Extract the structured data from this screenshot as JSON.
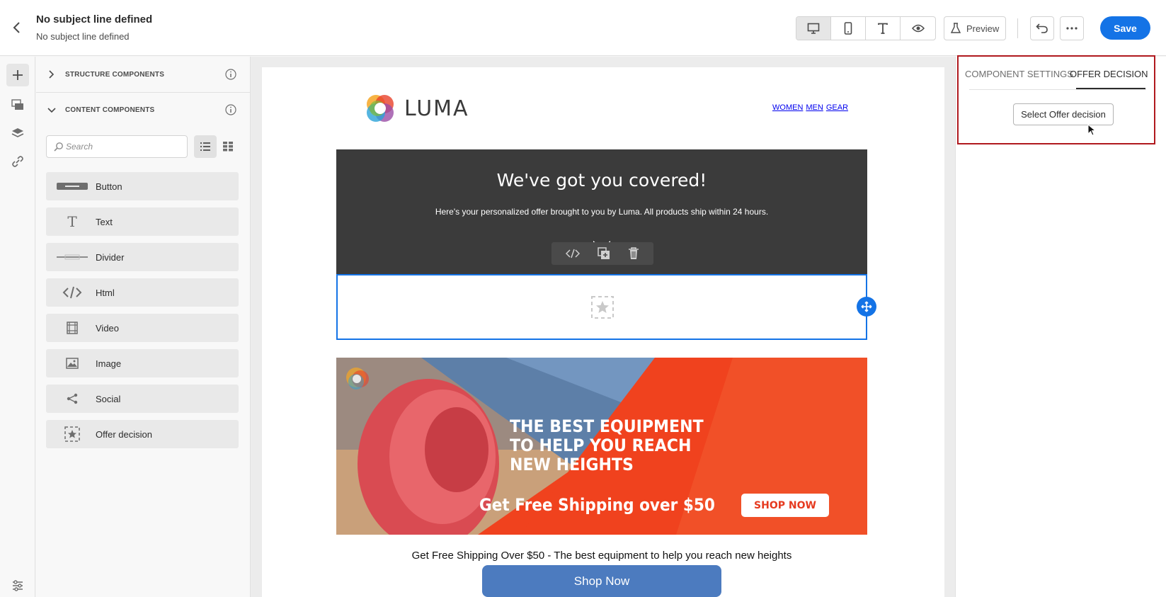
{
  "header": {
    "title": "No subject line defined",
    "subtitle": "No subject line defined",
    "preview_label": "Preview",
    "save_label": "Save",
    "view_modes": [
      "desktop-icon",
      "mobile-icon",
      "text-icon",
      "eye-icon"
    ]
  },
  "rail": {
    "icons": [
      "plus-icon",
      "assets-icon",
      "layers-icon",
      "link-icon",
      "settings-icon"
    ]
  },
  "components_panel": {
    "structure_label": "STRUCTURE COMPONENTS",
    "content_label": "CONTENT COMPONENTS",
    "search_placeholder": "Search",
    "items": [
      {
        "label": "Button",
        "icon": "button-icon"
      },
      {
        "label": "Text",
        "icon": "text-icon"
      },
      {
        "label": "Divider",
        "icon": "divider-icon"
      },
      {
        "label": "Html",
        "icon": "html-icon"
      },
      {
        "label": "Video",
        "icon": "video-icon"
      },
      {
        "label": "Image",
        "icon": "image-icon"
      },
      {
        "label": "Social",
        "icon": "share-icon"
      },
      {
        "label": "Offer decision",
        "icon": "offer-decision-icon"
      }
    ]
  },
  "email": {
    "logo_text": "LUMA",
    "nav": [
      "WOMEN",
      "MEN",
      "GEAR"
    ],
    "hero_title": "We've got you covered!",
    "hero_subtitle": "Here's your personalized offer brought to you by Luma. All products ship within 24 hours.",
    "banner_headline": [
      "THE BEST EQUIPMENT",
      "TO HELP YOU REACH",
      "NEW HEIGHTS"
    ],
    "banner_shipping": "Get Free Shipping over $50",
    "banner_button": "SHOP NOW",
    "caption": "Get Free Shipping Over $50 - The best equipment to help you reach new heights",
    "shop_now": "Shop Now"
  },
  "right_panel": {
    "tabs": [
      "COMPONENT SETTINGS",
      "OFFER DECISION"
    ],
    "active_tab": "OFFER DECISION",
    "select_button": "Select Offer decision"
  },
  "colors": {
    "accent": "#1473e6",
    "highlight_border": "#b0191e",
    "hero_bg": "#3b3b3b",
    "banner_orange": "#f0421e",
    "shop_button": "#4c7bbf"
  }
}
